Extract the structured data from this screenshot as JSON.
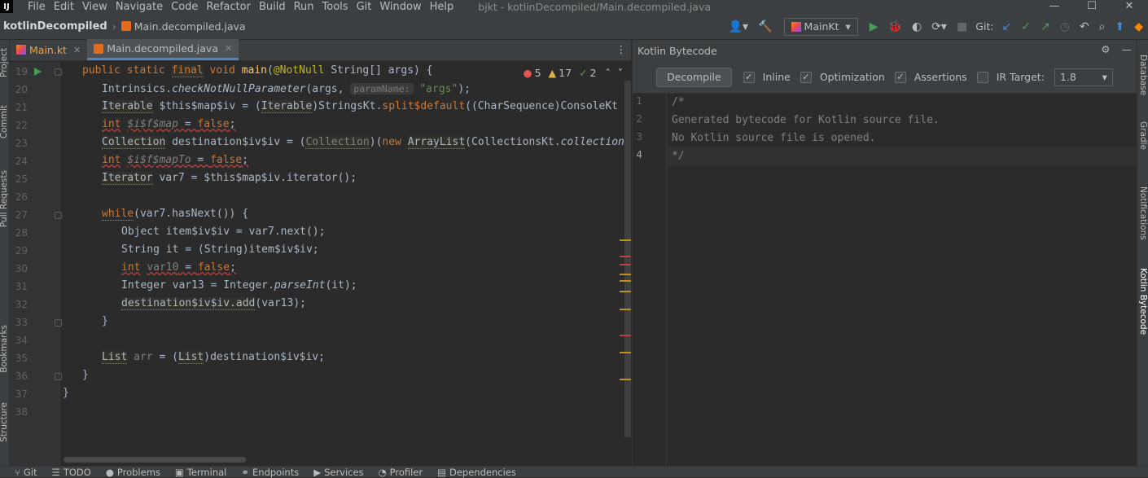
{
  "menubar": {
    "logo": "IJ",
    "items": [
      "File",
      "Edit",
      "View",
      "Navigate",
      "Code",
      "Refactor",
      "Build",
      "Run",
      "Tools",
      "Git",
      "Window",
      "Help"
    ],
    "title": "bjkt - kotlinDecompiled/Main.decompiled.java"
  },
  "navbar": {
    "project": "kotlinDecompiled",
    "file": "Main.decompiled.java"
  },
  "toolbar": {
    "run_config": "MainKt",
    "git_label": "Git:"
  },
  "left_tool_windows": [
    "Project",
    "Commit",
    "Pull Requests",
    "Bookmarks",
    "Structure"
  ],
  "right_tool_windows": [
    "Database",
    "Gradle",
    "Notifications",
    "Kotlin Bytecode"
  ],
  "tabs": [
    {
      "label": "Main.kt",
      "icon": "kotlin-file-icon"
    },
    {
      "label": "Main.decompiled.java",
      "icon": "java-file-icon",
      "active": true
    }
  ],
  "inspections": {
    "errors": "5",
    "warnings": "17",
    "weak_warnings": "2"
  },
  "editor": {
    "line_numbers": [
      "19",
      "20",
      "21",
      "22",
      "23",
      "24",
      "25",
      "26",
      "27",
      "28",
      "29",
      "30",
      "31",
      "32",
      "33",
      "34",
      "35",
      "36",
      "37",
      "38"
    ]
  },
  "bytecode": {
    "title": "Kotlin Bytecode",
    "decompile_label": "Decompile",
    "inline_label": "Inline",
    "optimization_label": "Optimization",
    "assertions_label": "Assertions",
    "ir_target_label": "IR Target:",
    "ir_target_value": "1.8",
    "line_numbers": [
      "1",
      "2",
      "3",
      "4"
    ],
    "lines": [
      "/*",
      "Generated bytecode for Kotlin source file.",
      "No Kotlin source file is opened.",
      "*/"
    ]
  },
  "statusbar": [
    "Git",
    "TODO",
    "Problems",
    "Terminal",
    "Endpoints",
    "Services",
    "Profiler",
    "Dependencies"
  ],
  "colors": {
    "keyword": "#cc7832",
    "function": "#ffc66d",
    "string": "#6a8759",
    "annotation": "#bbb529",
    "text": "#a9b7c6",
    "background": "#2b2b2b",
    "accent": "#4a88c7"
  }
}
